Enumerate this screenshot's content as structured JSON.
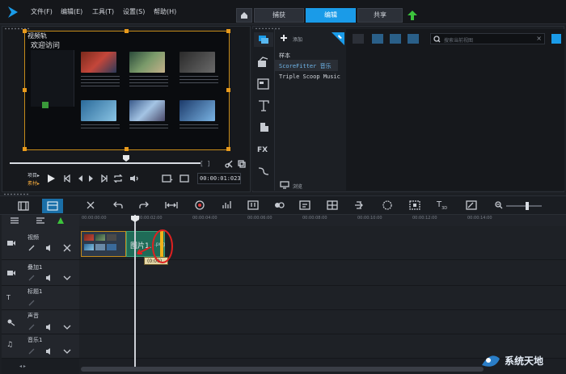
{
  "menu": {
    "items": [
      "文件(F)",
      "编辑(E)",
      "工具(T)",
      "设置(S)",
      "帮助(H)"
    ],
    "tabs": [
      "捕获",
      "编辑",
      "共享"
    ],
    "active_tab": "编辑"
  },
  "preview": {
    "overlay_label": "视频轨",
    "welcome_title": "欢迎访问",
    "labels": {
      "project": "项目▸",
      "clip": "素材▸"
    },
    "timecode": "00:00:01:023"
  },
  "library": {
    "add_label": "添加",
    "items": [
      "样本",
      "ScoreFitter 音乐",
      "Triple Scoop Music"
    ],
    "browse_label": "浏览",
    "search_placeholder": "搜索当前视图"
  },
  "timeline": {
    "ruler_ticks": [
      "00:00:00:00",
      "00:00:02:00",
      "00:00:04:00",
      "00:00:06:00",
      "00:00:08:00",
      "00:00:10:00",
      "00:00:12:00",
      "00:00:14:00"
    ],
    "tracks": [
      "视频",
      "叠加1",
      "标题1",
      "声音",
      "音乐1"
    ],
    "clip_label": "图片1.",
    "clip_extra": ".png",
    "tooltip": "(0:00)"
  },
  "watermark": {
    "text": "系统天地"
  },
  "colors": {
    "accent": "#1a9be8",
    "selection": "#e89a1c",
    "clip_green": "#1f6b57",
    "annotation_red": "#e02020"
  }
}
